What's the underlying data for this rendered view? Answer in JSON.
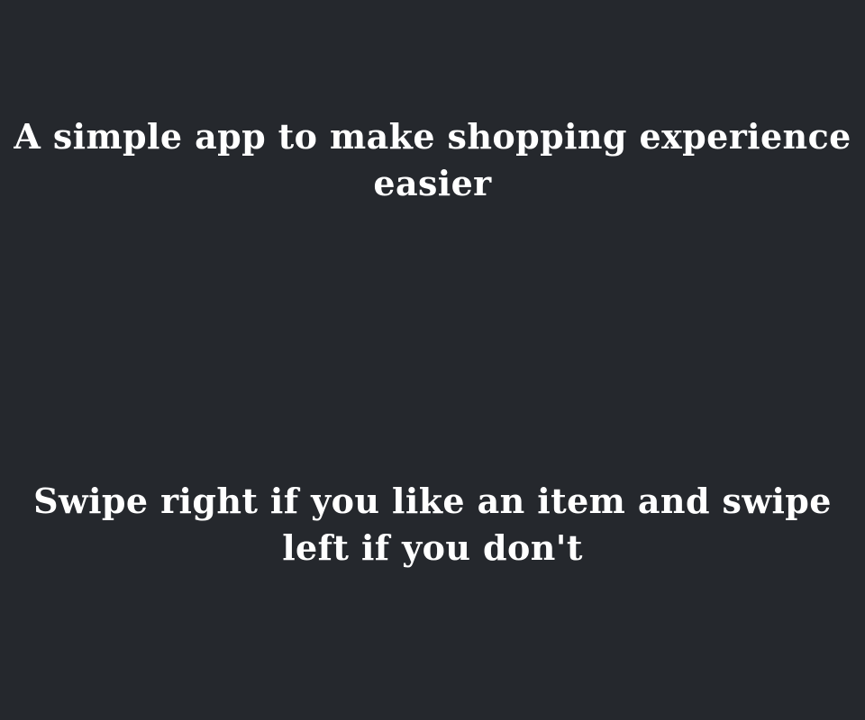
{
  "onboarding": {
    "headline_line1": "A simple app to make shopping experience",
    "headline_line2": "easier",
    "instruction_line1": "Swipe right if you like an item and swipe",
    "instruction_line2": "left if you don't"
  },
  "colors": {
    "background": "#25282d",
    "text": "#ffffff"
  }
}
